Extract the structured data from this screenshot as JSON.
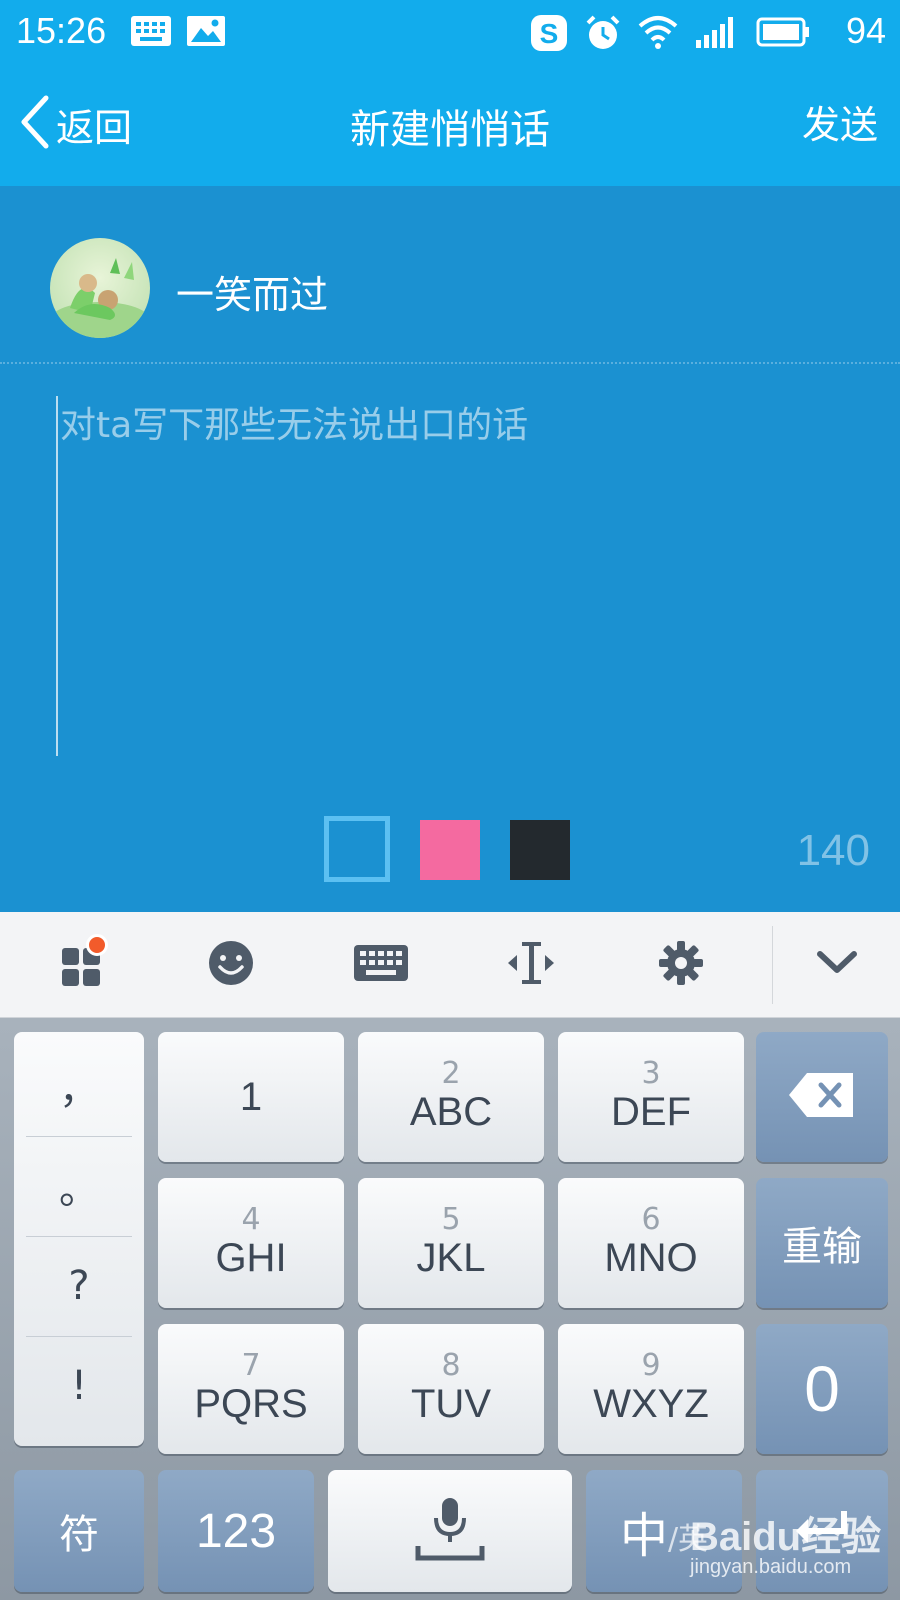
{
  "status_bar": {
    "time": "15:26",
    "battery": "94",
    "icons": [
      "keyboard-icon",
      "image-icon",
      "sogou-icon",
      "alarm-icon",
      "wifi-icon",
      "signal-icon",
      "battery-icon"
    ]
  },
  "title_bar": {
    "back_label": "返回",
    "title": "新建悄悄话",
    "send_label": "发送"
  },
  "compose": {
    "recipient": "一笑而过",
    "placeholder": "对ta写下那些无法说出口的话",
    "char_count": "140",
    "colors": {
      "background": "#1b91d1",
      "swatch_blue": "#5cc0f2",
      "swatch_pink": "#f46aa0",
      "swatch_black": "#23292e"
    }
  },
  "keyboard_toolbar": {
    "icons": [
      "apps-grid-icon",
      "emoji-icon",
      "keyboard-icon",
      "cursor-move-icon",
      "settings-gear-icon",
      "collapse-chevron-icon"
    ]
  },
  "keypad": {
    "punctuation": [
      "，",
      "。",
      "?",
      "!"
    ],
    "keys": [
      {
        "num": "",
        "letters": "1"
      },
      {
        "num": "2",
        "letters": "ABC"
      },
      {
        "num": "3",
        "letters": "DEF"
      },
      {
        "num": "4",
        "letters": "GHI"
      },
      {
        "num": "5",
        "letters": "JKL"
      },
      {
        "num": "6",
        "letters": "MNO"
      },
      {
        "num": "7",
        "letters": "PQRS"
      },
      {
        "num": "8",
        "letters": "TUV"
      },
      {
        "num": "9",
        "letters": "WXYZ"
      }
    ],
    "reinput_label": "重输",
    "zero_label": "0",
    "symbol_label": "符",
    "num123_label": "123",
    "lang_label": "中",
    "lang_alt_label": "/英"
  },
  "watermark": {
    "brand": "Baidu经验",
    "url": "jingyan.baidu.com"
  }
}
